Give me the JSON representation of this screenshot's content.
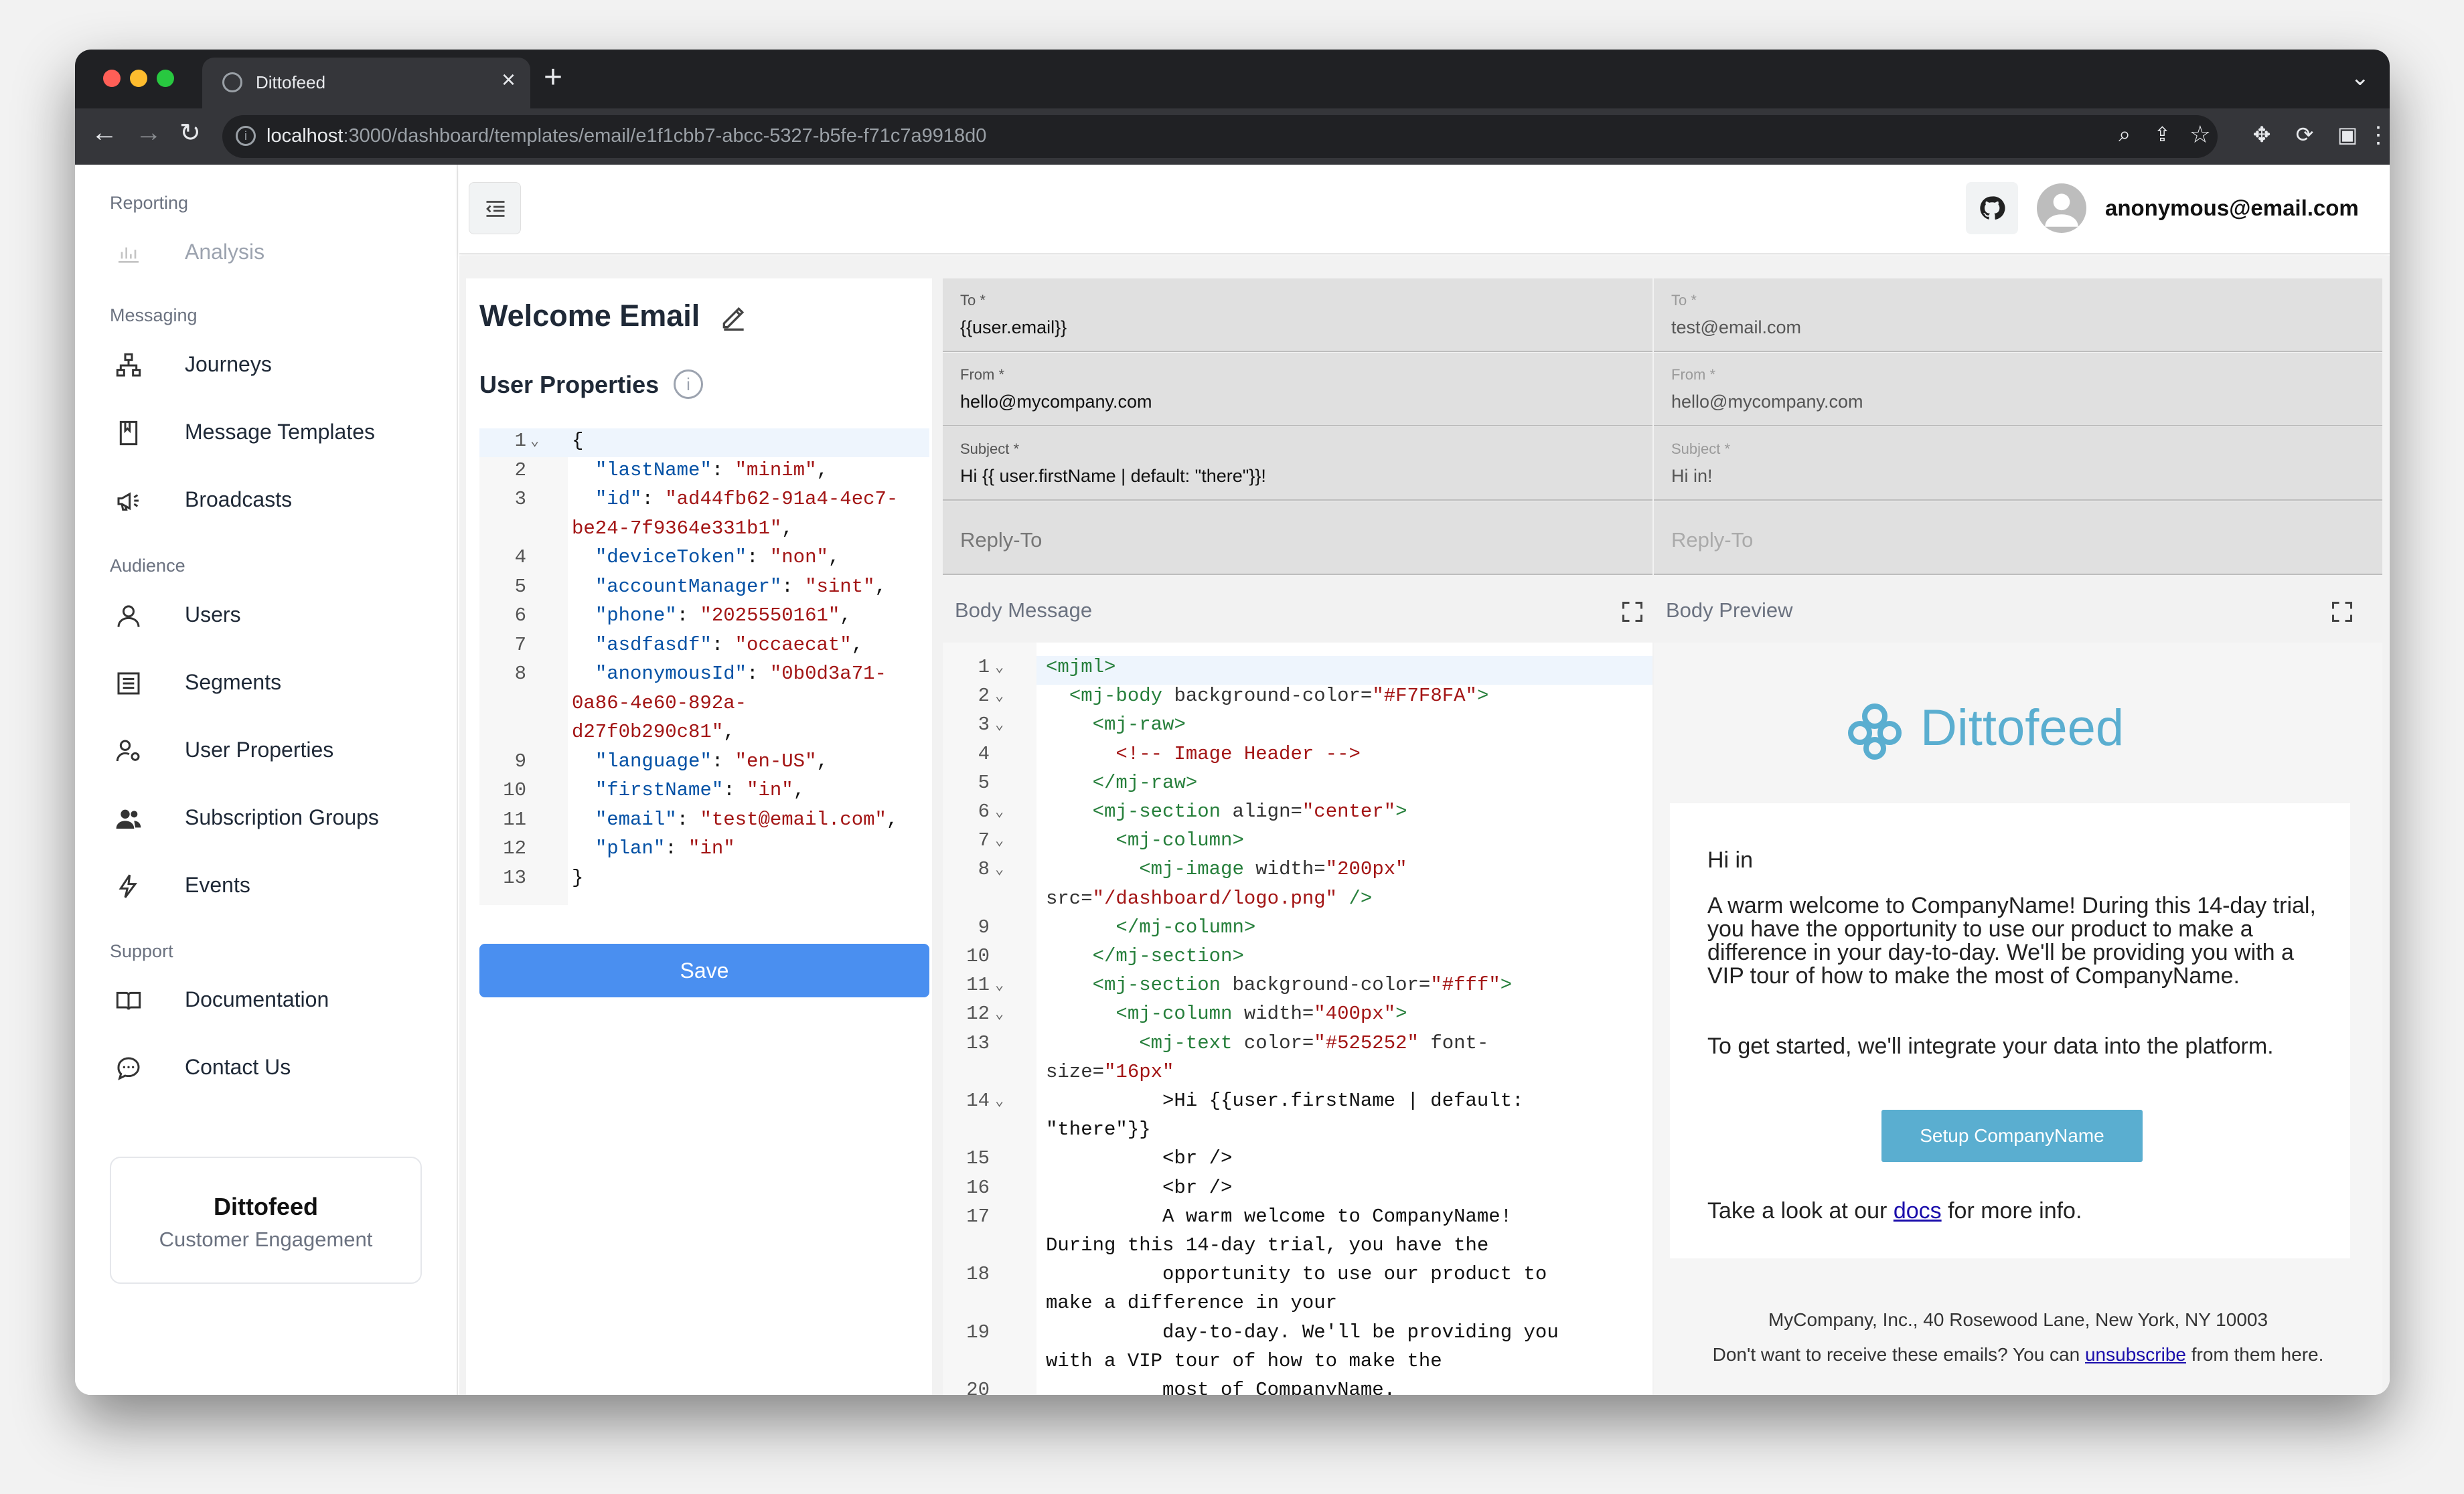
{
  "browser": {
    "tab_title": "Dittofeed",
    "url_host": "localhost",
    "url_path": ":3000/dashboard/templates/email/e1f1cbb7-abcc-5327-b5fe-f71c7a9918d0"
  },
  "sidebar": {
    "groups": {
      "reporting": "Reporting",
      "messaging": "Messaging",
      "audience": "Audience",
      "support": "Support"
    },
    "items": {
      "analysis": "Analysis",
      "journeys": "Journeys",
      "message_templates": "Message Templates",
      "broadcasts": "Broadcasts",
      "users": "Users",
      "segments": "Segments",
      "user_properties": "User Properties",
      "subscription_groups": "Subscription Groups",
      "events": "Events",
      "documentation": "Documentation",
      "contact_us": "Contact Us"
    },
    "brand_card": {
      "name": "Dittofeed",
      "tagline": "Customer Engagement"
    }
  },
  "header": {
    "user_email": "anonymous@email.com"
  },
  "template": {
    "title": "Welcome Email",
    "user_properties_title": "User Properties",
    "save_label": "Save",
    "user_properties_json": [
      {
        "n": "1",
        "fold": true,
        "parts": [
          [
            "",
            "{"
          ]
        ]
      },
      {
        "n": "2",
        "parts": [
          [
            "",
            "  "
          ],
          [
            "k",
            "\"lastName\""
          ],
          [
            "",
            ": "
          ],
          [
            "s",
            "\"minim\""
          ],
          [
            "",
            ","
          ]
        ]
      },
      {
        "n": "3",
        "parts": [
          [
            "",
            "  "
          ],
          [
            "k",
            "\"id\""
          ],
          [
            "",
            ": "
          ],
          [
            "s",
            "\"ad44fb62-91a4-4ec7-"
          ]
        ]
      },
      {
        "n": "",
        "parts": [
          [
            "s",
            "be24-7f9364e331b1\""
          ],
          [
            "",
            ","
          ]
        ]
      },
      {
        "n": "4",
        "parts": [
          [
            "",
            "  "
          ],
          [
            "k",
            "\"deviceToken\""
          ],
          [
            "",
            ": "
          ],
          [
            "s",
            "\"non\""
          ],
          [
            "",
            ","
          ]
        ]
      },
      {
        "n": "5",
        "parts": [
          [
            "",
            "  "
          ],
          [
            "k",
            "\"accountManager\""
          ],
          [
            "",
            ": "
          ],
          [
            "s",
            "\"sint\""
          ],
          [
            "",
            ","
          ]
        ]
      },
      {
        "n": "6",
        "parts": [
          [
            "",
            "  "
          ],
          [
            "k",
            "\"phone\""
          ],
          [
            "",
            ": "
          ],
          [
            "s",
            "\"2025550161\""
          ],
          [
            "",
            ","
          ]
        ]
      },
      {
        "n": "7",
        "parts": [
          [
            "",
            "  "
          ],
          [
            "k",
            "\"asdfasdf\""
          ],
          [
            "",
            ": "
          ],
          [
            "s",
            "\"occaecat\""
          ],
          [
            "",
            ","
          ]
        ]
      },
      {
        "n": "8",
        "parts": [
          [
            "",
            "  "
          ],
          [
            "k",
            "\"anonymousId\""
          ],
          [
            "",
            ": "
          ],
          [
            "s",
            "\"0b0d3a71-"
          ]
        ]
      },
      {
        "n": "",
        "parts": [
          [
            "s",
            "0a86-4e60-892a-"
          ]
        ]
      },
      {
        "n": "",
        "parts": [
          [
            "s",
            "d27f0b290c81\""
          ],
          [
            "",
            ","
          ]
        ]
      },
      {
        "n": "9",
        "parts": [
          [
            "",
            "  "
          ],
          [
            "k",
            "\"language\""
          ],
          [
            "",
            ": "
          ],
          [
            "s",
            "\"en-US\""
          ],
          [
            "",
            ","
          ]
        ]
      },
      {
        "n": "10",
        "parts": [
          [
            "",
            "  "
          ],
          [
            "k",
            "\"firstName\""
          ],
          [
            "",
            ": "
          ],
          [
            "s",
            "\"in\""
          ],
          [
            "",
            ","
          ]
        ]
      },
      {
        "n": "11",
        "parts": [
          [
            "",
            "  "
          ],
          [
            "k",
            "\"email\""
          ],
          [
            "",
            ": "
          ],
          [
            "s",
            "\"test@email.com\""
          ],
          [
            "",
            ","
          ]
        ]
      },
      {
        "n": "12",
        "parts": [
          [
            "",
            "  "
          ],
          [
            "k",
            "\"plan\""
          ],
          [
            "",
            ": "
          ],
          [
            "s",
            "\"in\""
          ]
        ]
      },
      {
        "n": "13",
        "parts": [
          [
            "",
            "}"
          ]
        ]
      }
    ]
  },
  "editor": {
    "to": {
      "label": "To *",
      "value": "{{user.email}}"
    },
    "from": {
      "label": "From *",
      "value": "hello@mycompany.com"
    },
    "subject": {
      "label": "Subject *",
      "value": "Hi {{ user.firstName | default: \"there\"}}!"
    },
    "reply_to": {
      "placeholder": "Reply-To"
    },
    "body_title": "Body Message",
    "body_code": [
      {
        "n": "1",
        "fold": true,
        "parts": [
          [
            "tag",
            "<mjml>"
          ]
        ]
      },
      {
        "n": "2",
        "fold": true,
        "parts": [
          [
            "",
            "  "
          ],
          [
            "tag",
            "<mj-body"
          ],
          [
            "attr",
            " background-color="
          ],
          [
            "s",
            "\"#F7F8FA\""
          ],
          [
            "tag",
            ">"
          ]
        ]
      },
      {
        "n": "3",
        "fold": true,
        "parts": [
          [
            "",
            "    "
          ],
          [
            "tag",
            "<mj-raw>"
          ]
        ]
      },
      {
        "n": "4",
        "parts": [
          [
            "",
            "      "
          ],
          [
            "cm",
            "<!-- Image Header -->"
          ]
        ]
      },
      {
        "n": "5",
        "parts": [
          [
            "",
            "    "
          ],
          [
            "tag",
            "</mj-raw>"
          ]
        ]
      },
      {
        "n": "6",
        "fold": true,
        "parts": [
          [
            "",
            "    "
          ],
          [
            "tag",
            "<mj-section"
          ],
          [
            "attr",
            " align="
          ],
          [
            "s",
            "\"center\""
          ],
          [
            "tag",
            ">"
          ]
        ]
      },
      {
        "n": "7",
        "fold": true,
        "parts": [
          [
            "",
            "      "
          ],
          [
            "tag",
            "<mj-column>"
          ]
        ]
      },
      {
        "n": "8",
        "fold": true,
        "parts": [
          [
            "",
            "        "
          ],
          [
            "tag",
            "<mj-image"
          ],
          [
            "attr",
            " width="
          ],
          [
            "s",
            "\"200px\""
          ]
        ]
      },
      {
        "n": "",
        "parts": [
          [
            "attr",
            "src="
          ],
          [
            "s",
            "\"/dashboard/logo.png\""
          ],
          [
            "tag",
            " />"
          ]
        ]
      },
      {
        "n": "9",
        "parts": [
          [
            "",
            "      "
          ],
          [
            "tag",
            "</mj-column>"
          ]
        ]
      },
      {
        "n": "10",
        "parts": [
          [
            "",
            "    "
          ],
          [
            "tag",
            "</mj-section>"
          ]
        ]
      },
      {
        "n": "11",
        "fold": true,
        "parts": [
          [
            "",
            "    "
          ],
          [
            "tag",
            "<mj-section"
          ],
          [
            "attr",
            " background-color="
          ],
          [
            "s",
            "\"#fff\""
          ],
          [
            "tag",
            ">"
          ]
        ]
      },
      {
        "n": "12",
        "fold": true,
        "parts": [
          [
            "",
            "      "
          ],
          [
            "tag",
            "<mj-column"
          ],
          [
            "attr",
            " width="
          ],
          [
            "s",
            "\"400px\""
          ],
          [
            "tag",
            ">"
          ]
        ]
      },
      {
        "n": "13",
        "parts": [
          [
            "",
            "        "
          ],
          [
            "tag",
            "<mj-text"
          ],
          [
            "attr",
            " color="
          ],
          [
            "s",
            "\"#525252\""
          ],
          [
            "attr",
            " font-"
          ]
        ]
      },
      {
        "n": "",
        "parts": [
          [
            "attr",
            "size="
          ],
          [
            "s",
            "\"16px\""
          ]
        ]
      },
      {
        "n": "14",
        "fold": true,
        "parts": [
          [
            "",
            "          >Hi {{user.firstName | default:"
          ]
        ]
      },
      {
        "n": "",
        "parts": [
          [
            "",
            "\"there\"}}"
          ]
        ]
      },
      {
        "n": "15",
        "parts": [
          [
            "",
            "          <br />"
          ]
        ]
      },
      {
        "n": "16",
        "parts": [
          [
            "",
            "          <br />"
          ]
        ]
      },
      {
        "n": "17",
        "parts": [
          [
            "",
            "          A warm welcome to CompanyName!"
          ]
        ]
      },
      {
        "n": "",
        "parts": [
          [
            "",
            "During this 14-day trial, you have the"
          ]
        ]
      },
      {
        "n": "18",
        "parts": [
          [
            "",
            "          opportunity to use our product to"
          ]
        ]
      },
      {
        "n": "",
        "parts": [
          [
            "",
            "make a difference in your"
          ]
        ]
      },
      {
        "n": "19",
        "parts": [
          [
            "",
            "          day-to-day. We'll be providing you"
          ]
        ]
      },
      {
        "n": "",
        "parts": [
          [
            "",
            "with a VIP tour of how to make the"
          ]
        ]
      },
      {
        "n": "20",
        "parts": [
          [
            "",
            "          most of CompanyName."
          ]
        ]
      }
    ]
  },
  "preview": {
    "to": {
      "label": "To *",
      "value": "test@email.com"
    },
    "from": {
      "label": "From *",
      "value": "hello@mycompany.com"
    },
    "subject": {
      "label": "Subject *",
      "value": "Hi in!"
    },
    "reply_to": {
      "placeholder": "Reply-To"
    },
    "title": "Body Preview",
    "logo_text": "Dittofeed",
    "greeting": "Hi in",
    "para1": "A warm welcome to CompanyName! During this 14-day trial, you have the opportunity to use our product to make a difference in your day-to-day. We'll be providing you with a VIP tour of how to make the most of CompanyName.",
    "para2": "To get started, we'll integrate your data into the platform.",
    "cta": "Setup CompanyName",
    "look_pre": "Take a look at our ",
    "look_link": "docs",
    "look_post": " for more info.",
    "footer_address": "MyCompany, Inc., 40 Rosewood Lane, New York, NY 10003",
    "footer_unsub_pre": "Don't want to receive these emails? You can ",
    "footer_unsub_link": "unsubscribe",
    "footer_unsub_post": " from them here."
  },
  "colors": {
    "accent": "#4a8ff0",
    "brand": "#5aaed0",
    "sidebar_text": "#1f2937"
  }
}
